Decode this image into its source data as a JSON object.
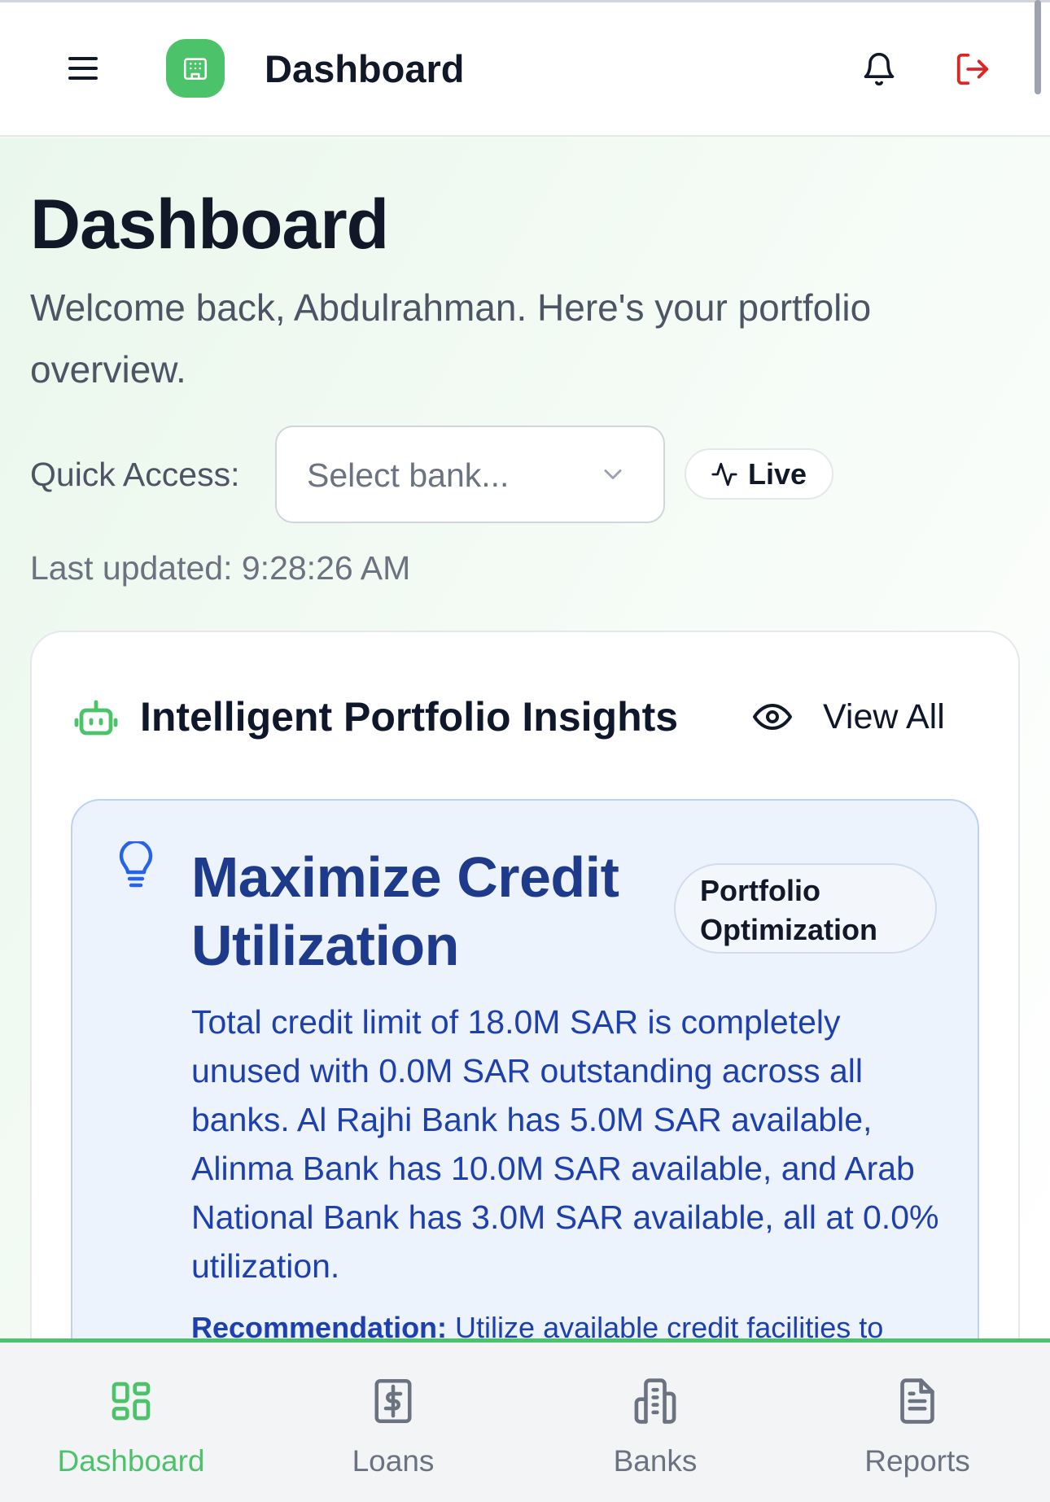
{
  "header": {
    "title": "Dashboard"
  },
  "page": {
    "title": "Dashboard",
    "welcome": "Welcome back, Abdulrahman. Here's your portfolio overview.",
    "quick_access_label": "Quick Access:",
    "bank_select_placeholder": "Select bank...",
    "live_label": "Live",
    "last_updated": "Last updated: 9:28:26 AM"
  },
  "insights_card": {
    "title": "Intelligent Portfolio Insights",
    "view_all_label": "View All",
    "insight": {
      "title": "Maximize Credit Utilization",
      "tag": "Portfolio Optimization",
      "body": "Total credit limit of 18.0M SAR is completely unused with 0.0M SAR outstanding across all banks. Al Rajhi Bank has 5.0M SAR available, Alinma Bank has 10.0M SAR available, and Arab National Bank has 3.0M SAR available, all at 0.0% utilization.",
      "recommendation_label": "Recommendation:",
      "recommendation_text": " Utilize available credit facilities to"
    }
  },
  "bottom_nav": {
    "items": [
      {
        "label": "Dashboard",
        "icon": "dashboard-grid-icon",
        "active": true
      },
      {
        "label": "Loans",
        "icon": "dollar-document-icon",
        "active": false
      },
      {
        "label": "Banks",
        "icon": "bank-building-icon",
        "active": false
      },
      {
        "label": "Reports",
        "icon": "report-document-icon",
        "active": false
      }
    ]
  },
  "colors": {
    "brand_green": "#4cc36b",
    "insight_blue": "#1e40af",
    "logout_red": "#dc2626"
  }
}
